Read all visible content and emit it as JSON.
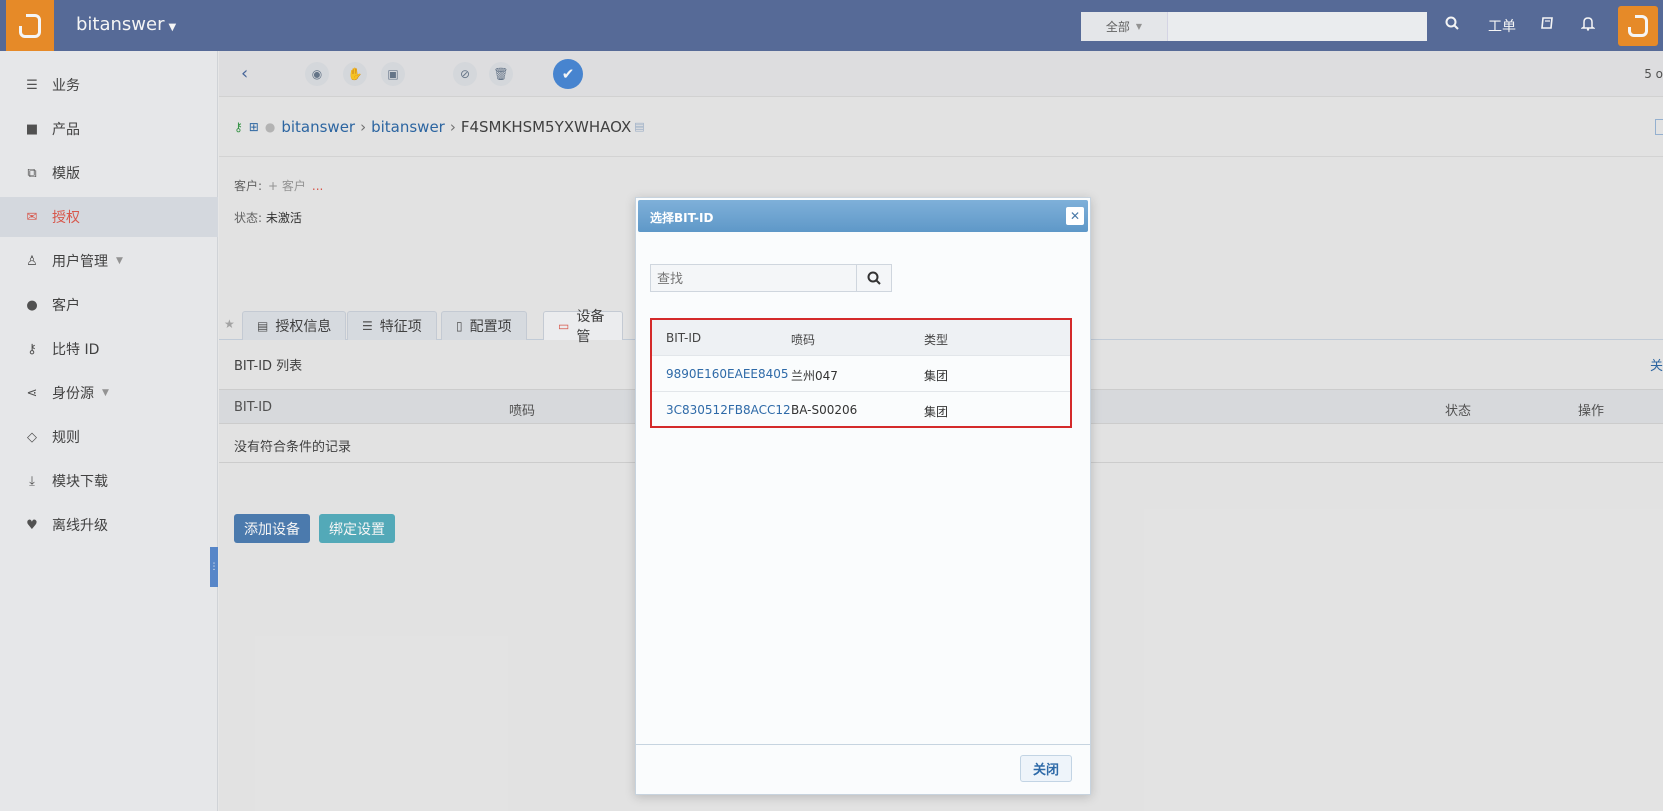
{
  "topbar": {
    "app_name": "bitanswer",
    "search_scope": "全部",
    "search_placeholder": "",
    "ticket_label": "工单"
  },
  "sidebar": {
    "items": [
      {
        "label": "业务",
        "icon": "sliders-icon"
      },
      {
        "label": "产品",
        "icon": "briefcase-icon"
      },
      {
        "label": "模版",
        "icon": "clone-icon"
      },
      {
        "label": "授权",
        "icon": "envelope-icon",
        "active": true
      },
      {
        "label": "用户管理",
        "icon": "user-icon"
      },
      {
        "label": "客户",
        "icon": "person-icon"
      },
      {
        "label": "比特 ID",
        "icon": "key-icon"
      },
      {
        "label": "身份源",
        "icon": "share-icon"
      },
      {
        "label": "规则",
        "icon": "diamond-icon"
      },
      {
        "label": "模块下载",
        "icon": "download-icon"
      },
      {
        "label": "离线升级",
        "icon": "heartbeat-icon"
      }
    ]
  },
  "toolbar": {
    "pager": "5 o"
  },
  "breadcrumb": {
    "parts": [
      "bitanswer",
      "bitanswer"
    ],
    "current": "F4SMKHSM5YXWHAOX"
  },
  "meta": {
    "customer_label": "客户:",
    "customer_add": "+ 客户",
    "customer_more": "...",
    "status_label": "状态:",
    "status_value": "未激活"
  },
  "tabs": [
    {
      "label": "授权信息",
      "icon": "list-alt-icon"
    },
    {
      "label": "特征项",
      "icon": "list-icon"
    },
    {
      "label": "配置项",
      "icon": "file-icon"
    },
    {
      "label": "设备管",
      "icon": "laptop-icon",
      "active": true
    }
  ],
  "list": {
    "title": "BIT-ID 列表",
    "right_text": "关",
    "columns": [
      "BIT-ID",
      "喷码",
      "状态",
      "操作"
    ],
    "empty_text": "没有符合条件的记录",
    "add_button": "添加设备",
    "bind_button": "绑定设置"
  },
  "modal": {
    "title": "选择BIT-ID",
    "search_placeholder": "查找",
    "columns": [
      "BIT-ID",
      "喷码",
      "类型"
    ],
    "rows": [
      {
        "id": "9890E160EAEE8405",
        "code": "兰州047",
        "type": "集团"
      },
      {
        "id": "3C830512FB8ACC12",
        "code": "BA-S00206",
        "type": "集团"
      }
    ],
    "close_button": "关闭"
  },
  "colors": {
    "topbar": "#5a6f9e",
    "brand_orange": "#f0902a",
    "active_nav": "#e05b4f",
    "link": "#2e6aa8",
    "highlight_border": "#d42a2a"
  }
}
